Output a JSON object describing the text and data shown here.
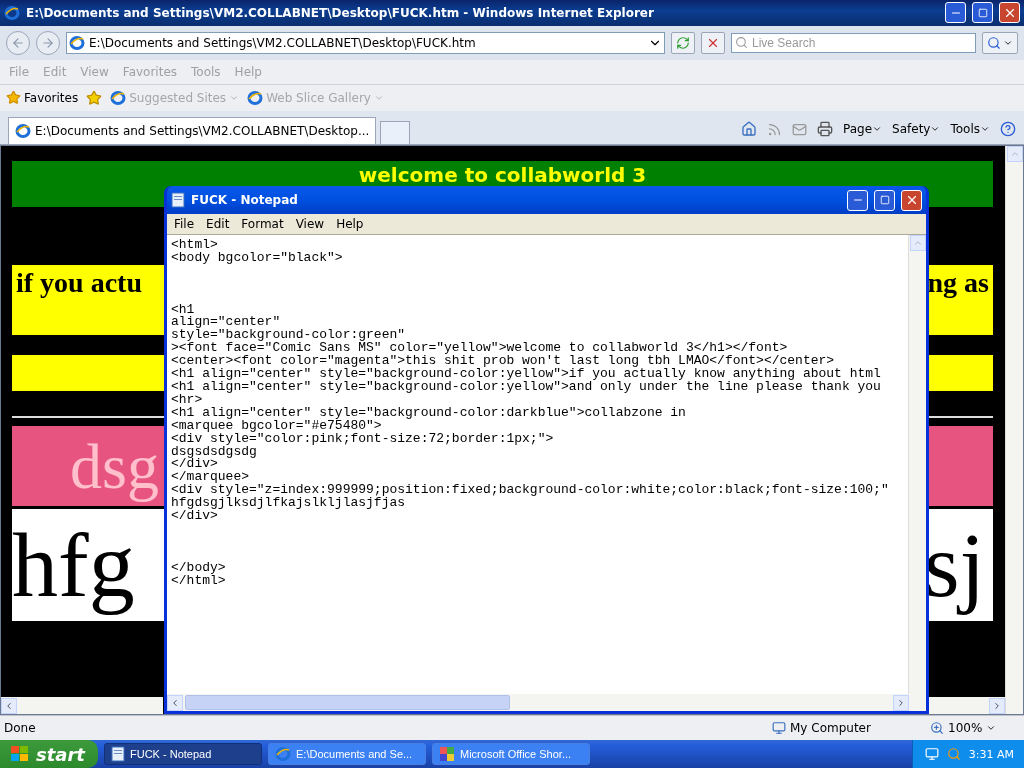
{
  "ie": {
    "title": "E:\\Documents and Settings\\VM2.COLLABNET\\Desktop\\FUCK.htm - Windows Internet Explorer",
    "address": "E:\\Documents and Settings\\VM2.COLLABNET\\Desktop\\FUCK.htm",
    "search_placeholder": "Live Search",
    "menu": [
      "File",
      "Edit",
      "View",
      "Favorites",
      "Tools",
      "Help"
    ],
    "favorites_label": "Favorites",
    "favorite_links": [
      "Suggested Sites",
      "Web Slice Gallery"
    ],
    "tabs": [
      {
        "label": "E:\\Documents and Settings\\VM2.COLLABNET\\Desktop...",
        "selected": true
      }
    ],
    "command_buttons": [
      "Page",
      "Safety",
      "Tools"
    ],
    "page": {
      "heading": "welcome to collabworld 3",
      "banner_left": "if you actu",
      "banner_right": "ng as",
      "marquee_text": "dsg",
      "overlay_left": "hfg",
      "overlay_right": "sj"
    },
    "status_bar": {
      "text": "Done",
      "zone": "My Computer",
      "zoom": "100%"
    }
  },
  "notepad": {
    "title": "FUCK - Notepad",
    "menu": [
      "File",
      "Edit",
      "Format",
      "View",
      "Help"
    ],
    "text": "<html>\n<body bgcolor=\"black\">\n\n\n\n<h1\nalign=\"center\"\nstyle=\"background-color:green\"\n><font face=\"Comic Sans MS\" color=\"yellow\">welcome to collabworld 3</h1></font>\n<center><font color=\"magenta\">this shit prob won't last long tbh LMAO</font></center>\n<h1 align=\"center\" style=\"background-color:yellow\">if you actually know anything about html\n<h1 align=\"center\" style=\"background-color:yellow\">and only under the line please thank you\n<hr>\n<h1 align=\"center\" style=\"background-color:darkblue\">collabzone in\n<marquee bgcolor=\"#e75480\">\n<div style=\"color:pink;font-size:72;border:1px;\">\ndsgsdsdgsdg\n</div>\n</marquee>\n<div style=\"z=index:999999;position:fixed;background-color:white;color:black;font-size:100;\"\nhfgdsgjlksdjlfkajslkljlasjfjas\n</div>\n\n\n\n</body>\n</html>"
  },
  "taskbar": {
    "start": "start",
    "items": [
      {
        "label": "FUCK - Notepad",
        "kind": "notepad",
        "selected": true
      },
      {
        "label": "E:\\Documents and Se...",
        "kind": "browser",
        "selected": false
      },
      {
        "label": "Microsoft Office Shor...",
        "kind": "office",
        "selected": false
      }
    ],
    "clock": "3:31 AM"
  }
}
